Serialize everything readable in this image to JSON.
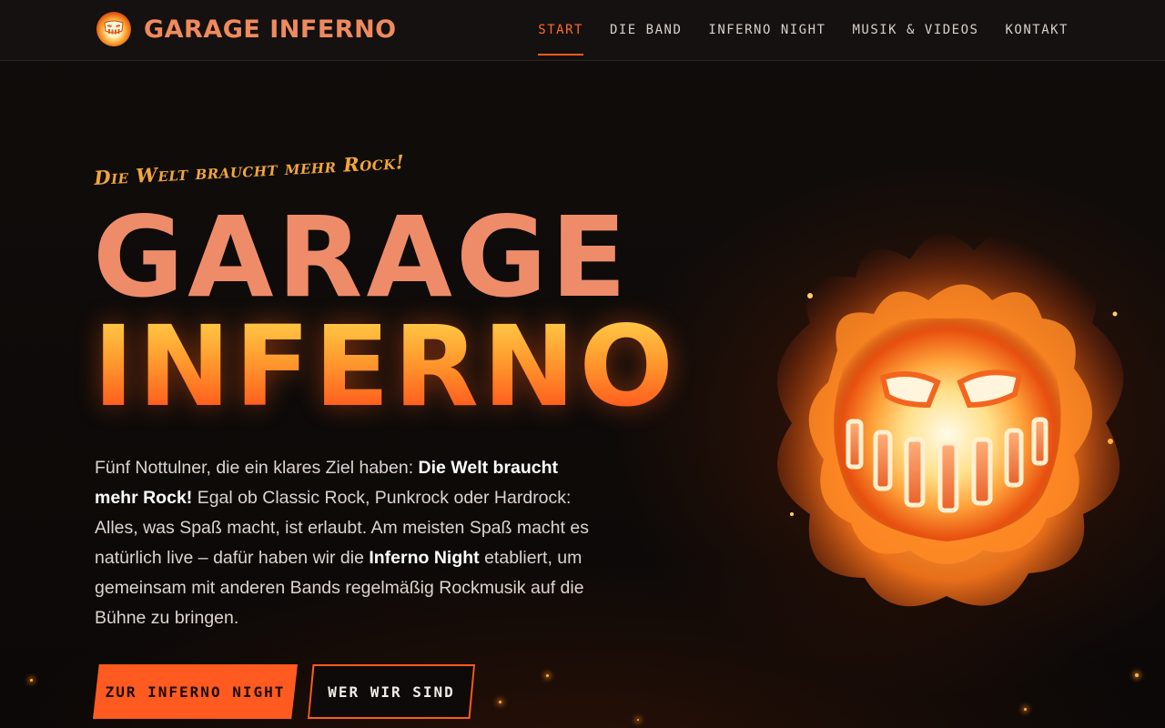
{
  "brand": {
    "name": "GARAGE INFERNO",
    "logo_icon": "flaming-skull-icon"
  },
  "nav": {
    "items": [
      {
        "label": "START",
        "active": true
      },
      {
        "label": "DIE BAND",
        "active": false
      },
      {
        "label": "INFERNO NIGHT",
        "active": false
      },
      {
        "label": "MUSIK & VIDEOS",
        "active": false
      },
      {
        "label": "KONTAKT",
        "active": false
      }
    ]
  },
  "hero": {
    "tagline": "Die Welt braucht mehr Rock!",
    "title_line1": "GARAGE",
    "title_line2": "INFERNO",
    "intro": {
      "p1": "Fünf Nottulner, die ein klares Ziel haben: ",
      "b1": "Die Welt braucht mehr Rock!",
      "p2": " Egal ob Classic Rock, Punkrock oder Hardrock: Alles, was Spaß macht, ist erlaubt. Am meisten Spaß macht es natürlich live – dafür haben wir die ",
      "b2": "Inferno Night",
      "p3": " etabliert, um gemeinsam mit anderen Bands regelmäßig Rockmusik auf die Bühne zu bringen."
    },
    "buttons": {
      "primary": "ZUR INFERNO NIGHT",
      "secondary": "WER WIR SIND"
    },
    "image_icon": "flaming-skull-icon"
  },
  "colors": {
    "accent": "#ff5a1f",
    "title_top": "#ee8c6a",
    "tagline": "#f2a53a",
    "background": "#0c0908"
  }
}
